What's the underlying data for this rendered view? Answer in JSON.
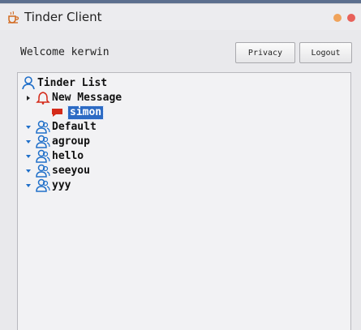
{
  "window": {
    "title": "Tinder Client"
  },
  "header": {
    "welcome": "Welcome kerwin",
    "privacy_label": "Privacy",
    "logout_label": "Logout"
  },
  "tree": {
    "root_label": "Tinder List",
    "new_message": {
      "label": "New Message",
      "children": [
        {
          "label": "simon"
        }
      ]
    },
    "groups": [
      {
        "label": "Default"
      },
      {
        "label": "agroup"
      },
      {
        "label": "hello"
      },
      {
        "label": "seeyou"
      },
      {
        "label": "yyy"
      }
    ]
  },
  "colors": {
    "accent_blue": "#2d6bc4",
    "user_icon_blue": "#1f6fc9",
    "message_red": "#d42a1a"
  }
}
